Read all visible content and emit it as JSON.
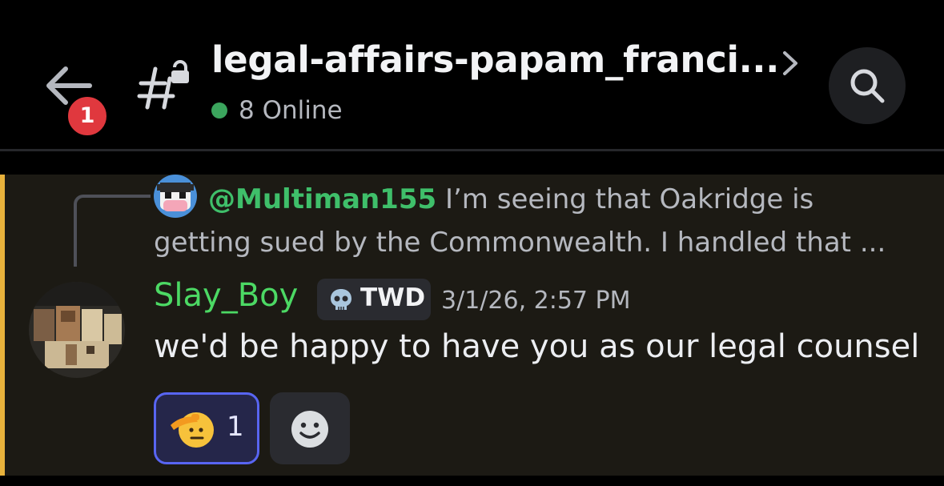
{
  "header": {
    "notification_count": "1",
    "channel_name": "legal-affairs-papam_franci...",
    "online_status": "8 Online",
    "channel_icon": "locked-text-channel-icon",
    "search_icon": "search-icon",
    "back_icon": "arrow-left-icon"
  },
  "message": {
    "reply": {
      "mention": "@Multiman155",
      "text": " I’m seeing that Oakridge is getting sued by the Commonwealth. I handled that ..."
    },
    "author": {
      "name": "Slay_Boy",
      "tag": "TWD",
      "tag_icon": "skull-icon"
    },
    "timestamp": "3/1/26, 2:57 PM",
    "content": "we'd be happy to have you as our legal counsel",
    "reactions": [
      {
        "emoji": "saluting-face-icon",
        "count": "1"
      }
    ],
    "add_reaction_icon": "smiley-add-reaction-icon"
  },
  "colors": {
    "background": "#000000",
    "message_highlight": "#1c1a14",
    "highlight_bar": "#e8b23c",
    "username": "#4cd964",
    "mention": "#3fbf6a",
    "online": "#3ba55d",
    "badge": "#e0383e",
    "reaction_border": "#5865f2"
  }
}
